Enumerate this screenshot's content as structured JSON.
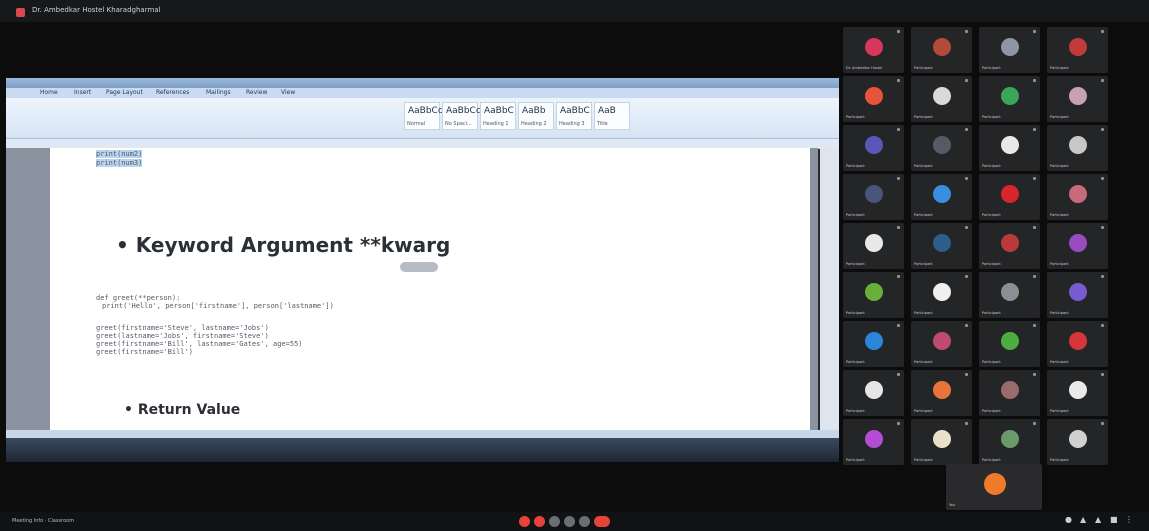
{
  "meeting": {
    "title": "Dr. Ambedkar Hostel Kharadgharmal"
  },
  "document": {
    "bullet1": "• Keyword Argument **kwarg",
    "bullet2": "• Return Value",
    "code_top": [
      "print(num2)",
      "print(num3)"
    ],
    "code_def": [
      "def greet(**person):",
      "print('Hello', person['firstname'], person['lastname'])"
    ],
    "code_calls": [
      "greet(firstname='Steve', lastname='Jobs')",
      "greet(lastname='Jobs', firstname='Steve')",
      "greet(firstname='Bill', lastname='Gates', age=55)",
      "greet(firstname='Bill')"
    ]
  },
  "ribbon": {
    "tabs": [
      "Home",
      "Insert",
      "Page Layout",
      "References",
      "Mailings",
      "Review",
      "View"
    ],
    "styles": [
      {
        "sample": "AaBbCc",
        "label": "Normal"
      },
      {
        "sample": "AaBbCc",
        "label": "No Spaci..."
      },
      {
        "sample": "AaBbC",
        "label": "Heading 1"
      },
      {
        "sample": "AaBb",
        "label": "Heading 2"
      },
      {
        "sample": "AaBbC",
        "label": "Heading 3"
      },
      {
        "sample": "AaB",
        "label": "Title"
      }
    ]
  },
  "participants": [
    {
      "name": "Dr. Ambedkar Hostel",
      "color": "#d6375b"
    },
    {
      "name": "Participant",
      "color": "#b34b3a"
    },
    {
      "name": "Participant",
      "color": "#8e96a3"
    },
    {
      "name": "Participant",
      "color": "#c13b3b"
    },
    {
      "name": "Participant",
      "color": "#e8533a"
    },
    {
      "name": "Participant",
      "color": "#d9d9d9"
    },
    {
      "name": "Participant",
      "color": "#3aa65a"
    },
    {
      "name": "Participant",
      "color": "#c9a0b4"
    },
    {
      "name": "Participant",
      "color": "#5b57b8"
    },
    {
      "name": "Participant",
      "color": "#555b64"
    },
    {
      "name": "Participant",
      "color": "#e8e8e8"
    },
    {
      "name": "Participant",
      "color": "#c7c7c7"
    },
    {
      "name": "Participant",
      "color": "#48557a"
    },
    {
      "name": "Participant",
      "color": "#3a8ee0"
    },
    {
      "name": "Participant",
      "color": "#d8252c"
    },
    {
      "name": "Participant",
      "color": "#c86a7a"
    },
    {
      "name": "Participant",
      "color": "#e8e8e8"
    },
    {
      "name": "Participant",
      "color": "#2d5d8a"
    },
    {
      "name": "Participant",
      "color": "#b83a3a"
    },
    {
      "name": "Participant",
      "color": "#9a4bc2"
    },
    {
      "name": "Participant",
      "color": "#68b03a"
    },
    {
      "name": "Participant",
      "color": "#f0f0f0"
    },
    {
      "name": "Participant",
      "color": "#8a8f96"
    },
    {
      "name": "Participant",
      "color": "#7a5ad0"
    },
    {
      "name": "Participant",
      "color": "#2b85d8"
    },
    {
      "name": "Participant",
      "color": "#c04a70"
    },
    {
      "name": "Participant",
      "color": "#4cae3e"
    },
    {
      "name": "Participant",
      "color": "#d8343c"
    },
    {
      "name": "Participant",
      "color": "#e6e6e6"
    },
    {
      "name": "Participant",
      "color": "#e8743b"
    },
    {
      "name": "Participant",
      "color": "#9a6b6b"
    },
    {
      "name": "Participant",
      "color": "#eaeaea"
    },
    {
      "name": "Participant",
      "color": "#b34ed4"
    },
    {
      "name": "Participant",
      "color": "#e8e0c8"
    },
    {
      "name": "Participant",
      "color": "#6a9a6a"
    },
    {
      "name": "Participant",
      "color": "#d0d0d0"
    }
  ],
  "self_view": {
    "name": "You",
    "color": "#f07a2b"
  },
  "bottom": {
    "status": "Meeting Info  · Classroom"
  },
  "controls": [
    "#e8433b",
    "#e8433b",
    "#6b6e74",
    "#6b6e74",
    "#6b6e74",
    "#e8433b"
  ],
  "colors": {
    "accent": "#e8433b"
  }
}
